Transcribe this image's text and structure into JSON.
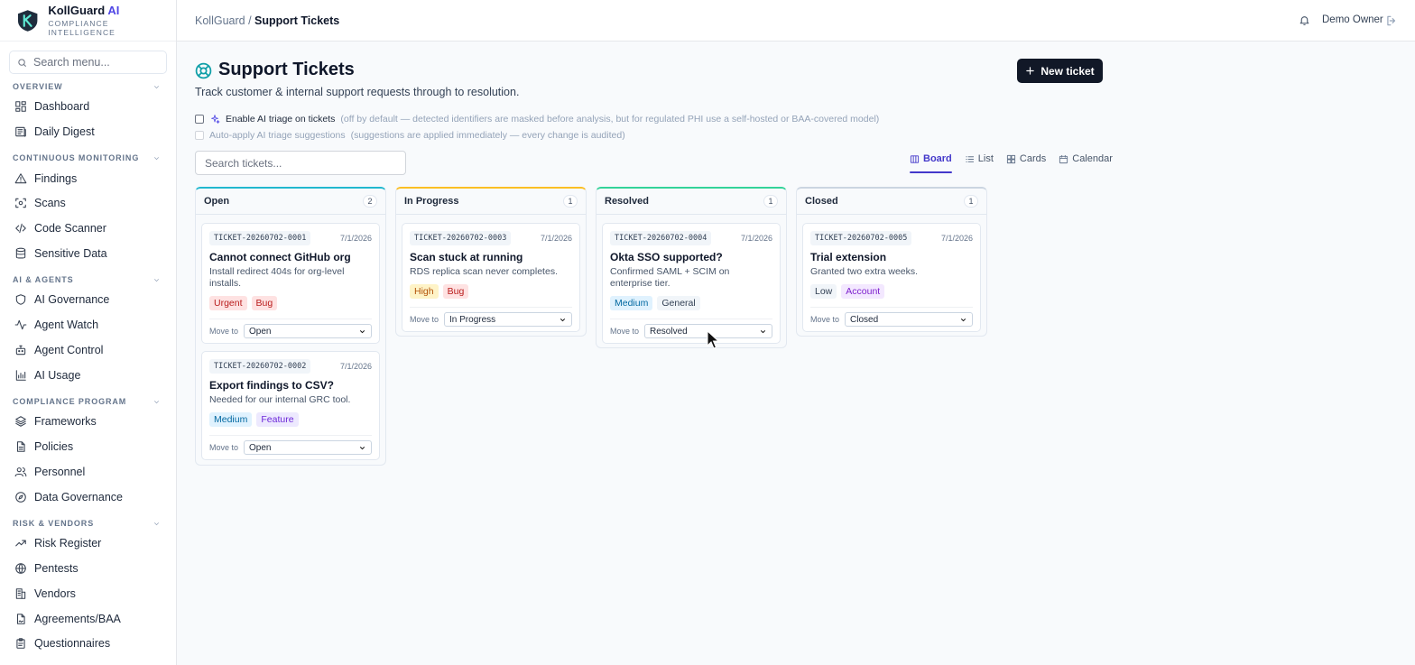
{
  "brand": {
    "name": "KollGuard",
    "ai": "AI",
    "subtitle": "COMPLIANCE INTELLIGENCE"
  },
  "sidebar": {
    "search_placeholder": "Search menu...",
    "sections": [
      {
        "label": "OVERVIEW",
        "items": [
          {
            "label": "Dashboard",
            "icon": "dashboard-icon"
          },
          {
            "label": "Daily Digest",
            "icon": "newspaper-icon"
          }
        ]
      },
      {
        "label": "CONTINUOUS MONITORING",
        "items": [
          {
            "label": "Findings",
            "icon": "warning-icon"
          },
          {
            "label": "Scans",
            "icon": "scan-icon"
          },
          {
            "label": "Code Scanner",
            "icon": "code-icon"
          },
          {
            "label": "Sensitive Data",
            "icon": "database-icon"
          }
        ]
      },
      {
        "label": "AI & AGENTS",
        "items": [
          {
            "label": "AI Governance",
            "icon": "shield-icon"
          },
          {
            "label": "Agent Watch",
            "icon": "activity-icon"
          },
          {
            "label": "Agent Control",
            "icon": "bot-icon"
          },
          {
            "label": "AI Usage",
            "icon": "bar-chart-icon"
          }
        ]
      },
      {
        "label": "COMPLIANCE PROGRAM",
        "items": [
          {
            "label": "Frameworks",
            "icon": "layers-icon"
          },
          {
            "label": "Policies",
            "icon": "document-icon"
          },
          {
            "label": "Personnel",
            "icon": "users-icon"
          },
          {
            "label": "Data Governance",
            "icon": "compass-icon"
          }
        ]
      },
      {
        "label": "RISK & VENDORS",
        "items": [
          {
            "label": "Risk Register",
            "icon": "trending-up-icon"
          },
          {
            "label": "Pentests",
            "icon": "globe-icon"
          },
          {
            "label": "Vendors",
            "icon": "building-icon"
          },
          {
            "label": "Agreements/BAA",
            "icon": "file-signature-icon"
          },
          {
            "label": "Questionnaires",
            "icon": "clipboard-icon"
          }
        ]
      }
    ]
  },
  "topbar": {
    "breadcrumb_root": "KollGuard",
    "breadcrumb_sep": " / ",
    "breadcrumb_current": "Support Tickets",
    "user": "Demo Owner"
  },
  "page": {
    "title": "Support Tickets",
    "subtitle": "Track customer & internal support requests through to resolution.",
    "new_button": "New ticket",
    "ai_triage_label": "Enable AI triage on tickets",
    "ai_triage_note": "(off by default — detected identifiers are masked before analysis, but for regulated PHI use a self-hosted or BAA-covered model)",
    "auto_apply_label": "Auto-apply AI triage suggestions",
    "auto_apply_note": "(suggestions are applied immediately — every change is audited)",
    "search_placeholder": "Search tickets..."
  },
  "views": [
    "Board",
    "List",
    "Cards",
    "Calendar"
  ],
  "active_view": "Board",
  "move_to_label": "Move to",
  "columns": [
    {
      "name": "Open",
      "count": "2",
      "accent": "#22b8cf",
      "tickets": [
        {
          "id": "TICKET-20260702-0001",
          "date": "7/1/2026",
          "title": "Cannot connect GitHub org",
          "desc": "Install redirect 404s for org-level installs.",
          "tags": [
            {
              "text": "Urgent",
              "bg": "#fee2e2",
              "fg": "#b91c1c"
            },
            {
              "text": "Bug",
              "bg": "#fee2e2",
              "fg": "#b91c1c"
            }
          ],
          "status": "Open"
        },
        {
          "id": "TICKET-20260702-0002",
          "date": "7/1/2026",
          "title": "Export findings to CSV?",
          "desc": "Needed for our internal GRC tool.",
          "tags": [
            {
              "text": "Medium",
              "bg": "#e0f2fe",
              "fg": "#0369a1"
            },
            {
              "text": "Feature",
              "bg": "#ede9fe",
              "fg": "#6d28d9"
            }
          ],
          "status": "Open"
        }
      ]
    },
    {
      "name": "In Progress",
      "count": "1",
      "accent": "#fbbf24",
      "tickets": [
        {
          "id": "TICKET-20260702-0003",
          "date": "7/1/2026",
          "title": "Scan stuck at running",
          "desc": "RDS replica scan never completes.",
          "tags": [
            {
              "text": "High",
              "bg": "#fef3c7",
              "fg": "#b45309"
            },
            {
              "text": "Bug",
              "bg": "#fee2e2",
              "fg": "#b91c1c"
            }
          ],
          "status": "In Progress"
        }
      ]
    },
    {
      "name": "Resolved",
      "count": "1",
      "accent": "#34d399",
      "tickets": [
        {
          "id": "TICKET-20260702-0004",
          "date": "7/1/2026",
          "title": "Okta SSO supported?",
          "desc": "Confirmed SAML + SCIM on enterprise tier.",
          "tags": [
            {
              "text": "Medium",
              "bg": "#e0f2fe",
              "fg": "#0369a1"
            },
            {
              "text": "General",
              "bg": "#f1f5f9",
              "fg": "#334155"
            }
          ],
          "status": "Resolved"
        }
      ]
    },
    {
      "name": "Closed",
      "count": "1",
      "accent": "#cbd5e1",
      "tickets": [
        {
          "id": "TICKET-20260702-0005",
          "date": "7/1/2026",
          "title": "Trial extension",
          "desc": "Granted two extra weeks.",
          "tags": [
            {
              "text": "Low",
              "bg": "#f1f5f9",
              "fg": "#334155"
            },
            {
              "text": "Account",
              "bg": "#f3e8ff",
              "fg": "#7e22ce"
            }
          ],
          "status": "Closed"
        }
      ]
    }
  ]
}
